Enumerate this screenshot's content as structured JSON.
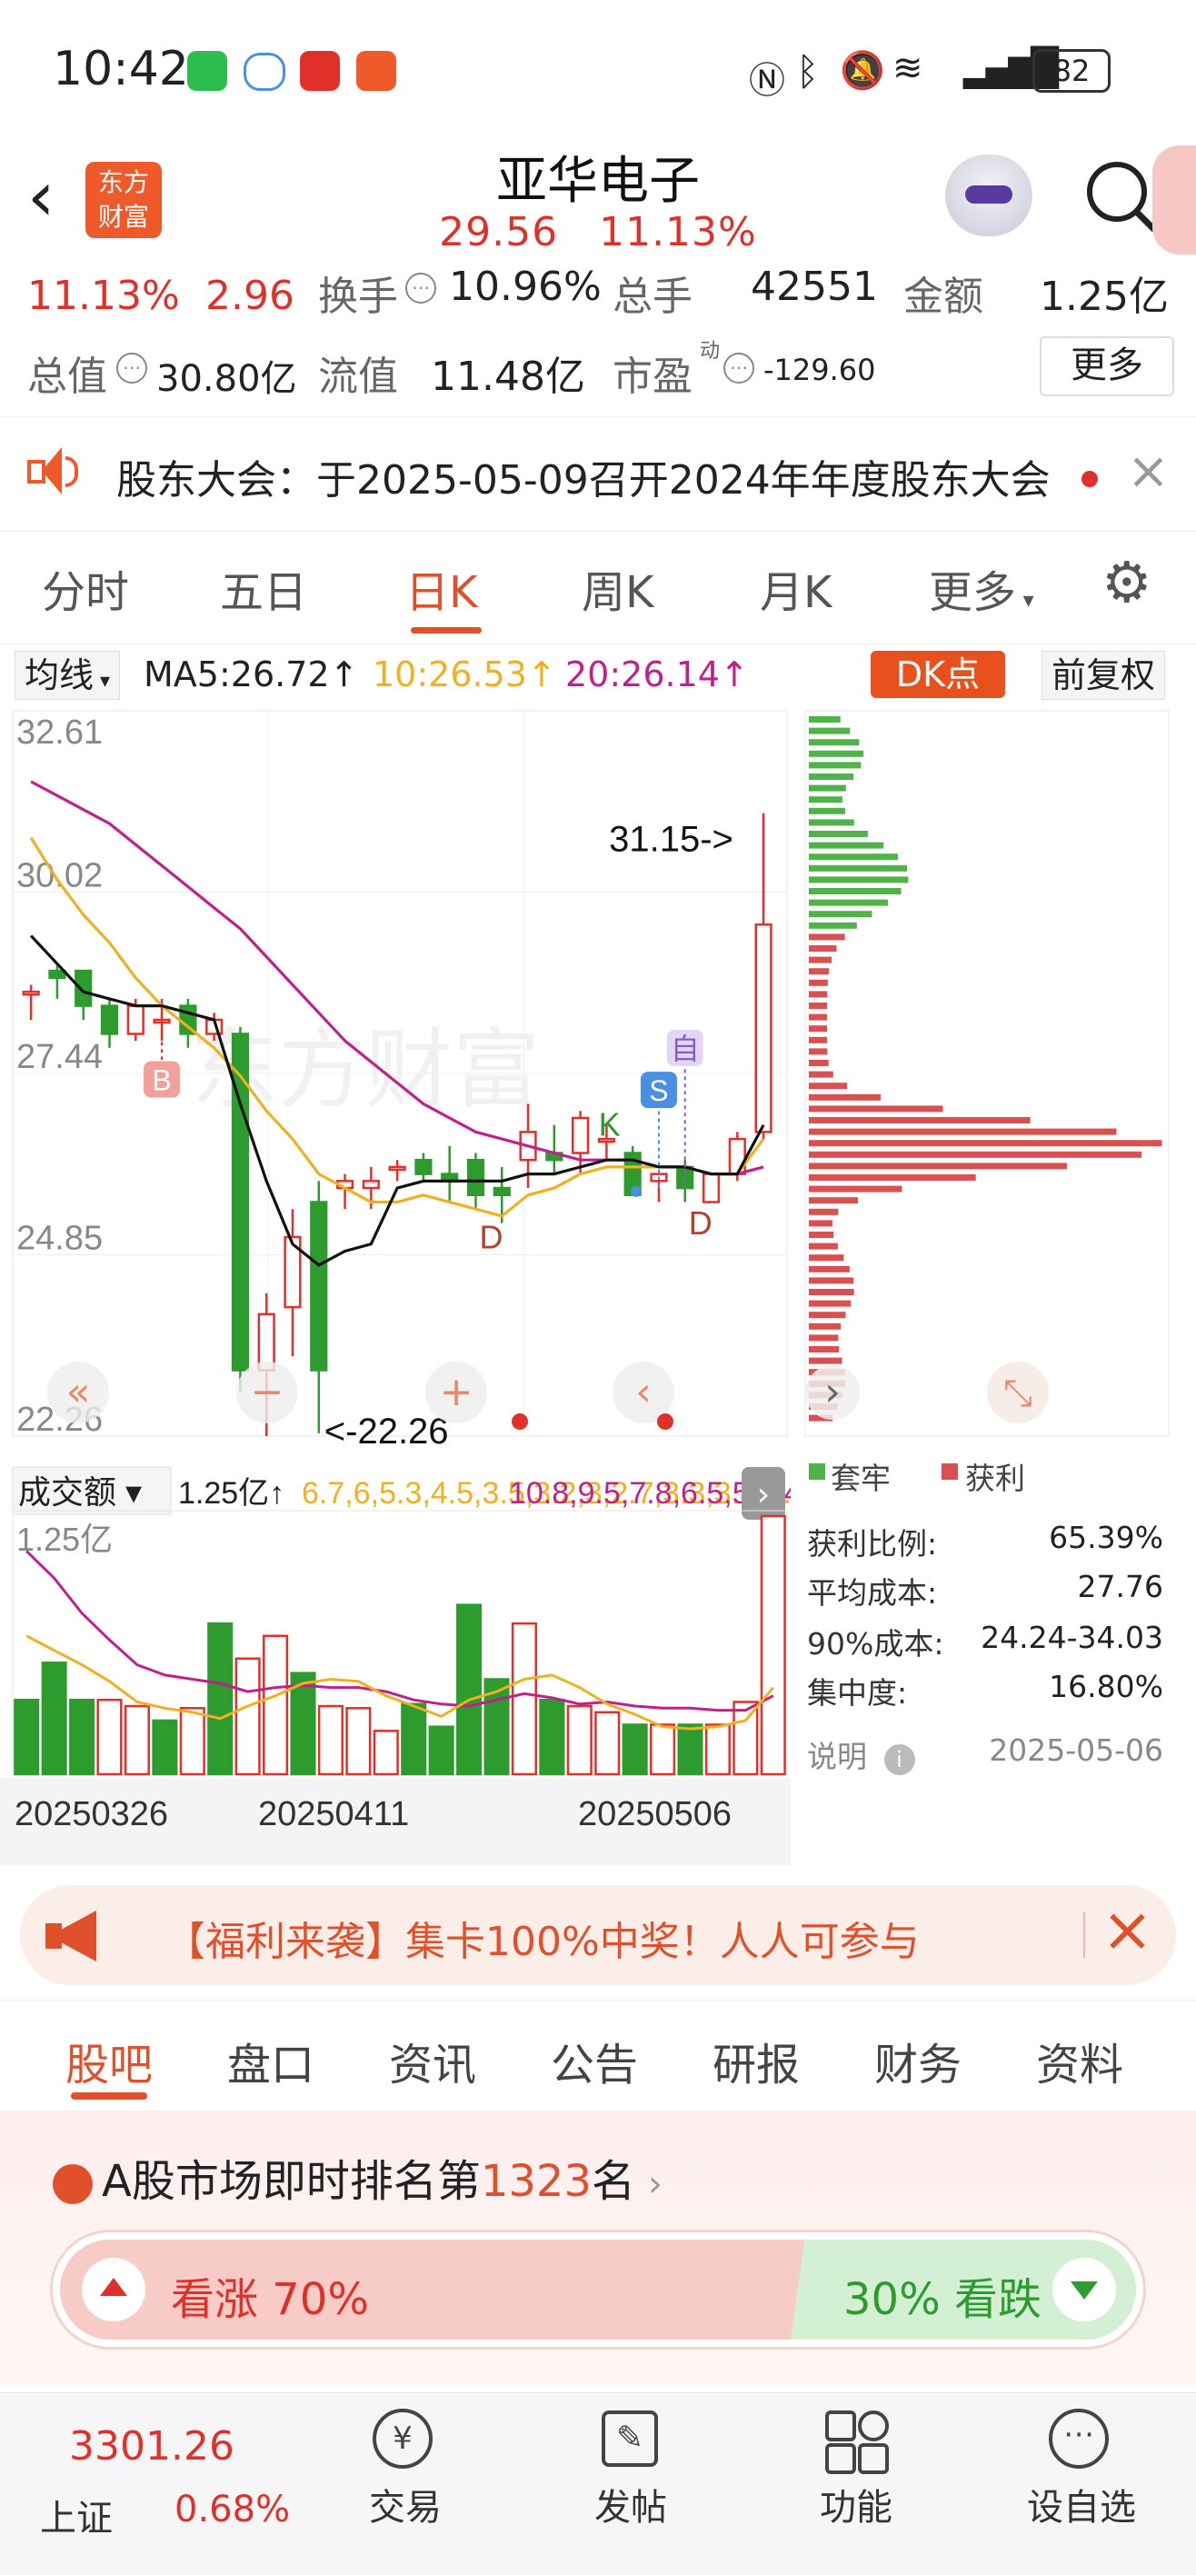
{
  "status_bar": {
    "time": "10:42",
    "battery": "82"
  },
  "header": {
    "logo_line1": "东方",
    "logo_line2": "财富",
    "name": "亚华电子",
    "price": "29.56",
    "change_pct": "11.13%"
  },
  "quote": {
    "pct": "11.13%",
    "chg": "2.96",
    "turnover_label": "换手",
    "turnover": "10.96%",
    "volume_label": "总手",
    "volume": "42551",
    "amount_label": "金额",
    "amount": "1.25亿",
    "mktcap_label": "总值",
    "mktcap": "30.80亿",
    "float_label": "流值",
    "float": "11.48亿",
    "pe_label": "市盈",
    "pe_sup": "动",
    "pe": "-129.60",
    "more": "更多"
  },
  "notice": {
    "text": "股东大会：于2025-05-09召开2024年年度股东大会"
  },
  "tabs": [
    "分时",
    "五日",
    "日K",
    "周K",
    "月K",
    "更多"
  ],
  "active_tab": 2,
  "ma_bar": {
    "selector": "均线",
    "ma5": "MA5:26.72↑",
    "ma10": "10:26.53↑",
    "ma20": "20:26.14↑",
    "dk": "DK点",
    "adjust": "前复权"
  },
  "chart_data": {
    "type": "candlestick",
    "y_ticks": [
      "32.61",
      "30.02",
      "27.44",
      "24.85",
      "22.26"
    ],
    "ylim": [
      22.26,
      32.61
    ],
    "high_label": "31.15->",
    "low_label": "<-22.26",
    "markers": [
      "B",
      "S",
      "自",
      "K",
      "D",
      "D"
    ],
    "candles": [
      [
        28.6,
        28.7,
        28.2,
        28.6
      ],
      [
        28.9,
        29.0,
        28.5,
        28.8
      ],
      [
        28.9,
        28.9,
        28.2,
        28.4
      ],
      [
        28.4,
        28.5,
        27.8,
        28.0
      ],
      [
        28.0,
        28.5,
        27.9,
        28.4
      ],
      [
        28.2,
        28.5,
        27.9,
        28.2
      ],
      [
        28.4,
        28.5,
        27.8,
        28.0
      ],
      [
        28.0,
        28.3,
        27.9,
        28.2
      ],
      [
        28.0,
        28.1,
        22.9,
        23.2
      ],
      [
        23.2,
        24.3,
        22.26,
        24.0
      ],
      [
        24.1,
        25.5,
        23.4,
        25.1
      ],
      [
        25.6,
        25.9,
        22.3,
        23.2
      ],
      [
        25.8,
        26.0,
        25.5,
        25.9
      ],
      [
        25.8,
        26.1,
        25.5,
        25.9
      ],
      [
        26.1,
        26.2,
        25.9,
        26.1
      ],
      [
        26.2,
        26.3,
        25.9,
        26.0
      ],
      [
        26.0,
        26.4,
        25.6,
        25.9
      ],
      [
        26.2,
        26.3,
        25.5,
        25.7
      ],
      [
        25.8,
        26.1,
        25.3,
        25.7
      ],
      [
        26.2,
        27.0,
        25.8,
        26.6
      ],
      [
        26.3,
        26.7,
        26.0,
        26.2
      ],
      [
        26.3,
        26.9,
        26.0,
        26.8
      ],
      [
        26.5,
        26.7,
        26.2,
        26.5
      ],
      [
        26.3,
        26.4,
        25.8,
        25.7
      ],
      [
        25.9,
        26.0,
        25.6,
        26.0
      ],
      [
        26.1,
        26.2,
        25.6,
        25.8
      ],
      [
        25.6,
        26.0,
        25.6,
        26.0
      ],
      [
        26.0,
        26.6,
        25.9,
        26.5
      ],
      [
        26.6,
        31.15,
        26.5,
        29.56
      ]
    ],
    "ma5": [
      29.4,
      29.0,
      28.6,
      28.5,
      28.4,
      28.4,
      28.3,
      28.2,
      27.0,
      25.9,
      25.0,
      24.7,
      24.9,
      25.0,
      25.8,
      25.9,
      25.9,
      25.9,
      25.9,
      26.0,
      26.0,
      26.1,
      26.2,
      26.2,
      26.1,
      26.1,
      26.0,
      26.0,
      26.7
    ],
    "ma10": [
      30.8,
      30.2,
      29.7,
      29.3,
      28.8,
      28.4,
      28.1,
      27.8,
      27.4,
      26.9,
      26.5,
      26.0,
      25.8,
      25.6,
      25.6,
      25.7,
      25.6,
      25.5,
      25.4,
      25.7,
      25.8,
      26.0,
      26.1,
      26.1,
      26.1,
      26.1,
      26.0,
      26.0,
      26.5
    ],
    "ma20": [
      31.6,
      31.4,
      31.2,
      31.0,
      30.7,
      30.4,
      30.1,
      29.8,
      29.5,
      29.1,
      28.7,
      28.3,
      27.9,
      27.6,
      27.3,
      27.0,
      26.8,
      26.6,
      26.5,
      26.4,
      26.3,
      26.2,
      26.2,
      26.2,
      26.1,
      26.1,
      26.0,
      26.0,
      26.1
    ],
    "volume": {
      "selector": "成交额",
      "current": "1.25亿↑",
      "ma1": [
        6.7,
        6.0,
        5.3,
        4.5,
        3.5,
        3.2,
        3.0,
        2.7,
        3.3,
        3.8,
        4.4,
        4.6,
        4.5,
        3.8,
        3.3,
        2.8,
        3.6,
        4.0,
        4.6,
        4.8,
        4.2,
        3.4,
        2.9,
        2.3,
        2.2,
        2.3,
        2.6,
        4.2
      ],
      "ma2": [
        10.8,
        9.5,
        7.8,
        6.5,
        5.3,
        4.8,
        4.6,
        4.4,
        4.0,
        4.2,
        4.3,
        4.2,
        4.2,
        4.0,
        3.6,
        3.4,
        3.3,
        3.6,
        3.9,
        3.7,
        3.4,
        3.5,
        3.3,
        3.2,
        3.2,
        3.1,
        3.1,
        3.8
      ],
      "top_label": "1.25亿",
      "dates": [
        "20250326",
        "20250411",
        "20250506"
      ],
      "values": [
        3.6,
        5.4,
        3.6,
        3.6,
        3.3,
        2.6,
        3.2,
        7.3,
        5.6,
        6.7,
        4.9,
        3.3,
        3.2,
        2.1,
        3.4,
        2.3,
        8.2,
        4.6,
        7.3,
        3.6,
        3.3,
        3.0,
        2.4,
        2.4,
        2.4,
        2.4,
        3.5,
        12.5
      ]
    },
    "volume_ylim": [
      0,
      12.5
    ]
  },
  "chip_profile": {
    "legend_loss": "套牢",
    "legend_profit": "获利",
    "stats": [
      {
        "label": "获利比例:",
        "value": "65.39%"
      },
      {
        "label": "平均成本:",
        "value": "27.76"
      },
      {
        "label": "90%成本:",
        "value": "24.24-34.03"
      },
      {
        "label": "集中度:",
        "value": "16.80%"
      }
    ],
    "note_label": "说明",
    "date": "2025-05-06"
  },
  "promo": {
    "text": "【福利来袭】集卡100%中奖！人人可参与"
  },
  "bottom_tabs": [
    "股吧",
    "盘口",
    "资讯",
    "公告",
    "研报",
    "财务",
    "资料"
  ],
  "ranking": {
    "prefix": "A股市场即时排名第",
    "rank": "1323",
    "suffix": "名"
  },
  "vote": {
    "up": "看涨 70%",
    "down": "30% 看跌"
  },
  "bottom_nav": {
    "index_value": "3301.26",
    "index_name": "上证",
    "index_pct": "0.68%",
    "items": [
      "交易",
      "发帖",
      "功能",
      "设自选"
    ]
  },
  "colors": {
    "up": "#e0302a",
    "down": "#2e9b2e",
    "accent": "#e0502a",
    "ma10": "#f0b020",
    "ma20": "#c0208a"
  }
}
